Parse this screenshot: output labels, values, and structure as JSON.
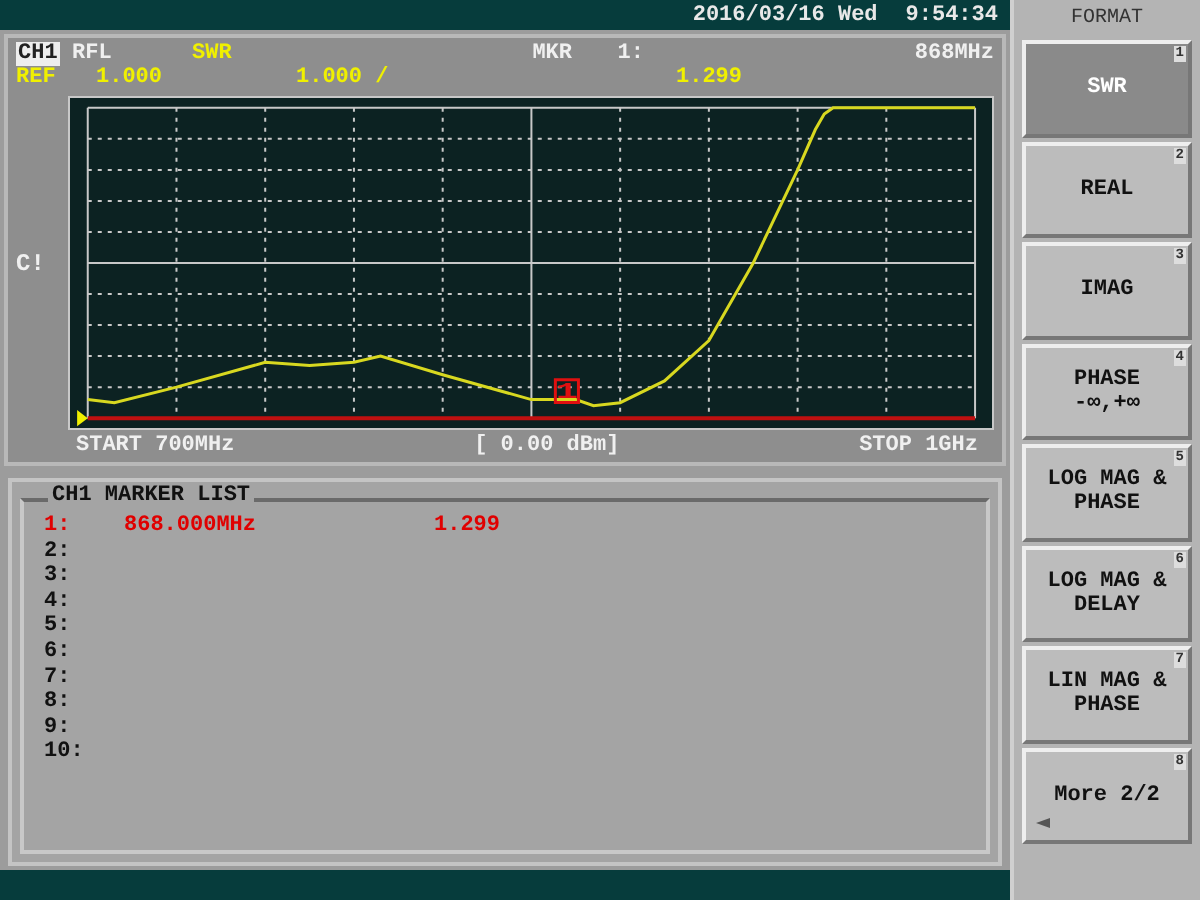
{
  "status_bar": {
    "date": "2016/03/16 Wed",
    "time": "9:54:34"
  },
  "trace_header": {
    "channel": "CH1",
    "measurement": "RFL",
    "format": "SWR",
    "marker_label": "MKR",
    "marker_number": "1:",
    "marker_frequency": "868MHz",
    "ref_label": "REF",
    "ref_value": "1.000",
    "scale": "1.000 /",
    "marker_value": "1.299"
  },
  "side_label": "C!",
  "marker_flag": "1",
  "sweep": {
    "start": "START 700MHz",
    "power": "[ 0.00 dBm]",
    "stop": "STOP 1GHz"
  },
  "marker_list": {
    "title": "CH1 MARKER LIST",
    "rows": [
      {
        "label": "1:",
        "frequency": "868.000MHz",
        "value": "1.299",
        "active": true
      },
      {
        "label": "2:",
        "active": false
      },
      {
        "label": "3:",
        "active": false
      },
      {
        "label": "4:",
        "active": false
      },
      {
        "label": "5:",
        "active": false
      },
      {
        "label": "6:",
        "active": false
      },
      {
        "label": "7:",
        "active": false
      },
      {
        "label": "8:",
        "active": false
      },
      {
        "label": "9:",
        "active": false
      },
      {
        "label": "10:",
        "active": false
      }
    ]
  },
  "softkeys": {
    "title": "FORMAT",
    "keys": [
      {
        "kind": "format",
        "lines": [
          "SWR"
        ],
        "number": "1",
        "selected": true
      },
      {
        "kind": "format",
        "lines": [
          "REAL"
        ],
        "number": "2",
        "selected": false
      },
      {
        "kind": "format",
        "lines": [
          "IMAG"
        ],
        "number": "3",
        "selected": false
      },
      {
        "kind": "format",
        "lines": [
          "PHASE",
          "-∞,+∞"
        ],
        "number": "4",
        "selected": false
      },
      {
        "kind": "format",
        "lines": [
          "LOG MAG &",
          "PHASE"
        ],
        "number": "5",
        "selected": false
      },
      {
        "kind": "format",
        "lines": [
          "LOG MAG &",
          "DELAY"
        ],
        "number": "6",
        "selected": false
      },
      {
        "kind": "format",
        "lines": [
          "LIN MAG &",
          "PHASE"
        ],
        "number": "7",
        "selected": false
      },
      {
        "kind": "menu",
        "lines": [
          "More 2/2"
        ],
        "number": "8",
        "selected": false
      }
    ]
  }
}
